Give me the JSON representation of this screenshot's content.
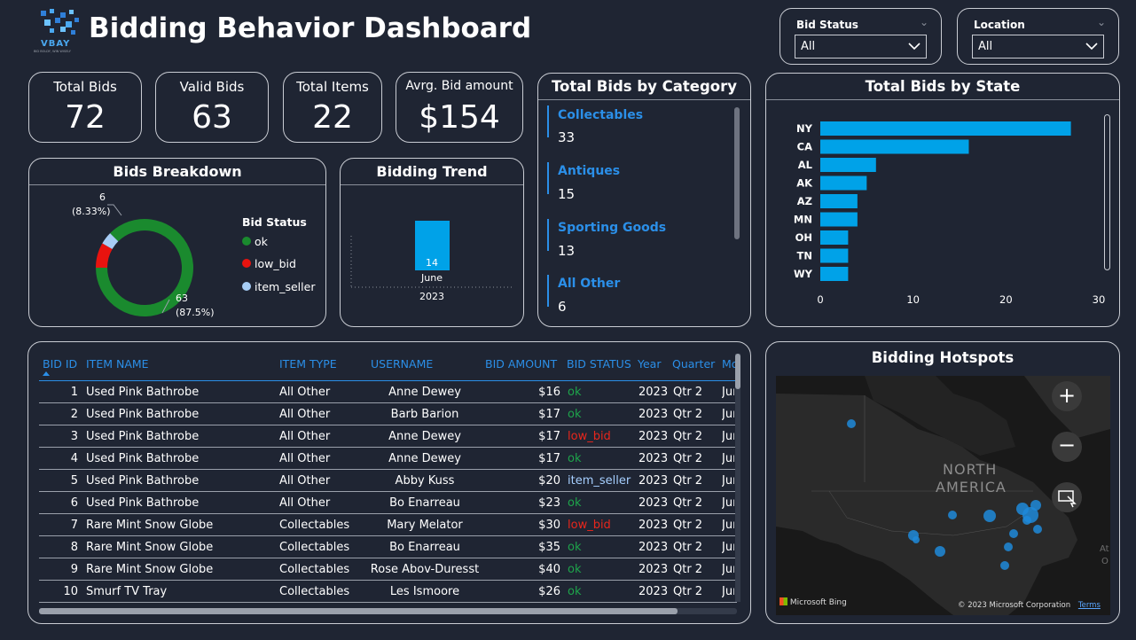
{
  "header": {
    "logo_text": "VBAY",
    "logo_tagline": "BID BOLDY, WIN WISELY",
    "title": "Bidding Behavior Dashboard"
  },
  "slicers": [
    {
      "label": "Bid Status",
      "value": "All"
    },
    {
      "label": "Location",
      "value": "All"
    }
  ],
  "kpis": [
    {
      "label": "Total Bids",
      "value": "72"
    },
    {
      "label": "Valid Bids",
      "value": "63"
    },
    {
      "label": "Total Items",
      "value": "22"
    },
    {
      "label": "Avrg. Bid amount",
      "value": "$154"
    }
  ],
  "breakdown": {
    "title": "Bids Breakdown",
    "legend_title": "Bid Status",
    "label_small_count": "6",
    "label_small_pct": "(8.33%)",
    "label_big_count": "63",
    "label_big_pct": "(87.5%)"
  },
  "trend": {
    "title": "Bidding Trend",
    "value_label": "14",
    "month": "June",
    "year": "2023"
  },
  "category": {
    "title": "Total Bids by Category",
    "items": [
      {
        "name": "Collectables",
        "value": "33"
      },
      {
        "name": "Antiques",
        "value": "15"
      },
      {
        "name": "Sporting Goods",
        "value": "13"
      },
      {
        "name": "All Other",
        "value": "6"
      }
    ]
  },
  "chart_data": [
    {
      "type": "pie",
      "title": "Bids Breakdown",
      "categories": [
        "ok",
        "low_bid",
        "item_seller"
      ],
      "values": [
        63,
        6,
        3
      ],
      "colors": [
        "#1a8a2e",
        "#e8130f",
        "#a7cdf5"
      ],
      "legend": "right"
    },
    {
      "type": "bar",
      "title": "Bidding Trend",
      "categories": [
        "June 2023"
      ],
      "values": [
        14
      ],
      "color": "#00a2e8"
    },
    {
      "type": "bar",
      "orientation": "horizontal",
      "title": "Total Bids by State",
      "categories": [
        "NY",
        "CA",
        "AL",
        "AK",
        "AZ",
        "MN",
        "OH",
        "TN",
        "WY"
      ],
      "values": [
        27,
        16,
        6,
        5,
        4,
        4,
        3,
        3,
        3
      ],
      "xlim": [
        0,
        30
      ],
      "xticks": [
        "0",
        "10",
        "20",
        "30"
      ],
      "color": "#00a2e8"
    }
  ],
  "table": {
    "columns": [
      "BID ID",
      "ITEM NAME",
      "ITEM TYPE",
      "USERNAME",
      "BID AMOUNT",
      "BID STATUS",
      "Year",
      "Quarter",
      "Mo"
    ],
    "rows": [
      [
        "1",
        "Used Pink Bathrobe",
        "All Other",
        "Anne Dewey",
        "$16",
        "ok",
        "2023",
        "Qtr 2",
        "Jun"
      ],
      [
        "2",
        "Used Pink Bathrobe",
        "All Other",
        "Barb Barion",
        "$17",
        "ok",
        "2023",
        "Qtr 2",
        "Jun"
      ],
      [
        "3",
        "Used Pink Bathrobe",
        "All Other",
        "Anne Dewey",
        "$17",
        "low_bid",
        "2023",
        "Qtr 2",
        "Jun"
      ],
      [
        "4",
        "Used Pink Bathrobe",
        "All Other",
        "Anne Dewey",
        "$17",
        "ok",
        "2023",
        "Qtr 2",
        "Jun"
      ],
      [
        "5",
        "Used Pink Bathrobe",
        "All Other",
        "Abby Kuss",
        "$20",
        "item_seller",
        "2023",
        "Qtr 2",
        "Jun"
      ],
      [
        "6",
        "Used Pink Bathrobe",
        "All Other",
        "Bo Enarreau",
        "$23",
        "ok",
        "2023",
        "Qtr 2",
        "Jun"
      ],
      [
        "7",
        "Rare Mint Snow Globe",
        "Collectables",
        "Mary Melator",
        "$30",
        "low_bid",
        "2023",
        "Qtr 2",
        "Jun"
      ],
      [
        "8",
        "Rare Mint Snow Globe",
        "Collectables",
        "Bo Enarreau",
        "$35",
        "ok",
        "2023",
        "Qtr 2",
        "Jun"
      ],
      [
        "9",
        "Rare Mint Snow Globe",
        "Collectables",
        "Rose Abov-Duresst",
        "$40",
        "ok",
        "2023",
        "Qtr 2",
        "Jun"
      ],
      [
        "10",
        "Smurf TV Tray",
        "Collectables",
        "Les Ismoore",
        "$26",
        "ok",
        "2023",
        "Qtr 2",
        "Jun"
      ]
    ]
  },
  "map": {
    "title": "Bidding Hotspots",
    "region_label_1": "NORTH",
    "region_label_2": "AMERICA",
    "side_label_1": "At",
    "side_label_2": "O",
    "attribution": "Microsoft Bing",
    "copyright": "© 2023 Microsoft Corporation",
    "terms": "Terms"
  }
}
